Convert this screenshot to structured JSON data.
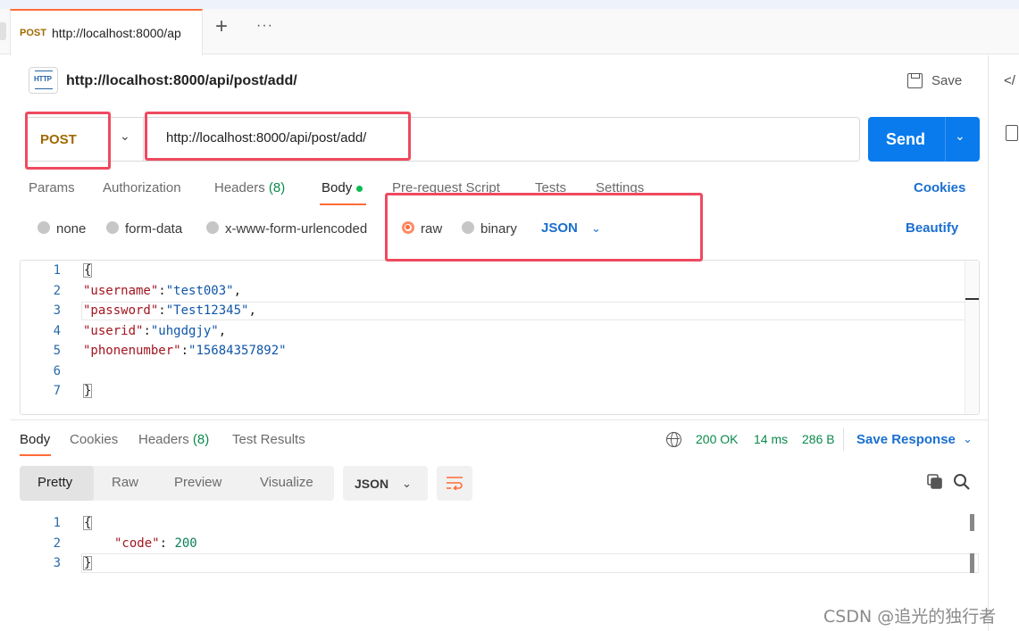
{
  "tab": {
    "method": "POST",
    "url": "http://localhost:8000/ap",
    "new_tab_symbol": "+",
    "more_symbol": "···"
  },
  "header": {
    "title": "http://localhost:8000/api/post/add/",
    "icon_text": "HTTP",
    "save_label": "Save"
  },
  "request": {
    "method": "POST",
    "url": "http://localhost:8000/api/post/add/",
    "send_label": "Send"
  },
  "request_tabs": [
    {
      "label": "Params"
    },
    {
      "label": "Authorization"
    },
    {
      "label": "Headers",
      "count": "(8)"
    },
    {
      "label": "Body"
    },
    {
      "label": "Pre-request Script"
    },
    {
      "label": "Tests"
    },
    {
      "label": "Settings"
    }
  ],
  "cookies_label": "Cookies",
  "body_types": [
    {
      "label": "none",
      "selected": false
    },
    {
      "label": "form-data",
      "selected": false
    },
    {
      "label": "x-www-form-urlencoded",
      "selected": false
    },
    {
      "label": "raw",
      "selected": true
    },
    {
      "label": "binary",
      "selected": false
    }
  ],
  "body_format": "JSON",
  "beautify_label": "Beautify",
  "editor": {
    "line_numbers": [
      "1",
      "2",
      "3",
      "4",
      "5",
      "6",
      "7"
    ],
    "open_brace": "{",
    "close_brace": "}",
    "fields": [
      {
        "key": "\"username\"",
        "value": "\"test003\""
      },
      {
        "key": "\"password\"",
        "value": "\"Test12345\""
      },
      {
        "key": "\"userid\"",
        "value": "\"uhgdgjy\""
      },
      {
        "key": "\"phonenumber\"",
        "value": "\"15684357892\""
      }
    ]
  },
  "response": {
    "tabs": [
      {
        "label": "Body"
      },
      {
        "label": "Cookies"
      },
      {
        "label": "Headers",
        "count": "(8)"
      },
      {
        "label": "Test Results"
      }
    ],
    "status": "200 OK",
    "time": "14 ms",
    "size": "286 B",
    "save_response_label": "Save Response",
    "views": [
      "Pretty",
      "Raw",
      "Preview",
      "Visualize"
    ],
    "format": "JSON",
    "line_numbers": [
      "1",
      "2",
      "3"
    ],
    "open_brace": "{",
    "key": "\"code\"",
    "value": "200",
    "close_brace": "}"
  },
  "watermark": "CSDN @追光的独行者",
  "colors": {
    "accent": "#ff6c37",
    "send": "#097bed",
    "link": "#1a6fd0",
    "highlight": "#ef4a5f",
    "post": "#a06a00",
    "ok": "#0a8a4a"
  }
}
